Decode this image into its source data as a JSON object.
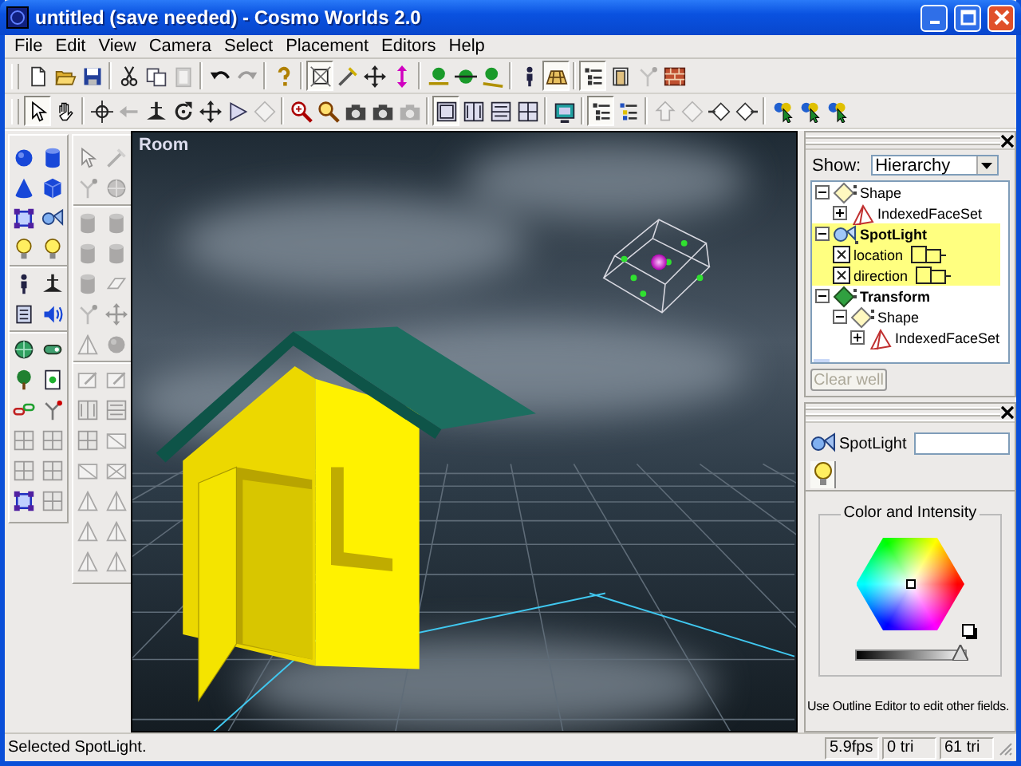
{
  "window": {
    "title": "untitled (save needed) - Cosmo Worlds 2.0"
  },
  "menu": [
    "File",
    "Edit",
    "View",
    "Camera",
    "Select",
    "Placement",
    "Editors",
    "Help"
  ],
  "toolbars": [
    {
      "groups": [
        [
          {
            "kind": "page",
            "pressed": false,
            "disabled": false
          },
          {
            "kind": "folder",
            "pressed": false,
            "disabled": false
          },
          {
            "kind": "floppy",
            "pressed": false,
            "disabled": false
          }
        ],
        [
          {
            "kind": "scissors",
            "pressed": false,
            "disabled": false
          },
          {
            "kind": "copy",
            "pressed": false,
            "disabled": false
          },
          {
            "kind": "clipboard",
            "pressed": false,
            "disabled": true
          }
        ],
        [
          {
            "kind": "undo",
            "pressed": false,
            "disabled": false
          },
          {
            "kind": "redo",
            "pressed": false,
            "disabled": true
          }
        ],
        [
          {
            "kind": "help",
            "pressed": false,
            "disabled": false
          }
        ],
        [
          {
            "kind": "frame",
            "pressed": true,
            "disabled": false
          },
          {
            "kind": "wand",
            "pressed": false,
            "disabled": false
          },
          {
            "kind": "move",
            "pressed": false,
            "disabled": false
          },
          {
            "kind": "lift",
            "pressed": false,
            "disabled": false
          }
        ],
        [
          {
            "kind": "drop",
            "pressed": false,
            "disabled": false
          },
          {
            "kind": "disc",
            "pressed": false,
            "disabled": false
          },
          {
            "kind": "slope",
            "pressed": false,
            "disabled": false
          }
        ],
        [
          {
            "kind": "figure",
            "pressed": false,
            "disabled": false
          },
          {
            "kind": "grid",
            "pressed": true,
            "disabled": false
          }
        ],
        [
          {
            "kind": "list",
            "pressed": true,
            "disabled": false
          },
          {
            "kind": "door",
            "pressed": false,
            "disabled": false
          },
          {
            "kind": "fork",
            "pressed": false,
            "disabled": true
          },
          {
            "kind": "brick",
            "pressed": false,
            "disabled": false
          }
        ]
      ]
    },
    {
      "groups": [
        [
          {
            "kind": "pointer",
            "pressed": true,
            "disabled": false
          },
          {
            "kind": "hand",
            "pressed": false,
            "disabled": false
          }
        ],
        [
          {
            "kind": "target",
            "pressed": false,
            "disabled": false
          },
          {
            "kind": "left",
            "pressed": false,
            "disabled": true
          },
          {
            "kind": "pin",
            "pressed": false,
            "disabled": false
          },
          {
            "kind": "rotate",
            "pressed": false,
            "disabled": false
          },
          {
            "kind": "move",
            "pressed": false,
            "disabled": false
          },
          {
            "kind": "play",
            "pressed": false,
            "disabled": false
          },
          {
            "kind": "diamond",
            "pressed": false,
            "disabled": true
          }
        ],
        [
          {
            "kind": "zoomin",
            "pressed": false,
            "disabled": false
          },
          {
            "kind": "zoom",
            "pressed": false,
            "disabled": false
          },
          {
            "kind": "camera",
            "pressed": false,
            "disabled": false
          },
          {
            "kind": "camera",
            "pressed": false,
            "disabled": false
          },
          {
            "kind": "camera",
            "pressed": false,
            "disabled": true
          }
        ],
        [
          {
            "kind": "view1",
            "pressed": true,
            "disabled": false
          },
          {
            "kind": "view2",
            "pressed": false,
            "disabled": false
          },
          {
            "kind": "view3",
            "pressed": false,
            "disabled": false
          },
          {
            "kind": "view4",
            "pressed": false,
            "disabled": false
          }
        ],
        [
          {
            "kind": "monitor",
            "pressed": false,
            "disabled": false
          }
        ],
        [
          {
            "kind": "list",
            "pressed": true,
            "disabled": false
          },
          {
            "kind": "list2",
            "pressed": false,
            "disabled": false
          }
        ],
        [
          {
            "kind": "up",
            "pressed": false,
            "disabled": true
          },
          {
            "kind": "diamond",
            "pressed": false,
            "disabled": true
          },
          {
            "kind": "ldiamond",
            "pressed": false,
            "disabled": false
          },
          {
            "kind": "rdiamond",
            "pressed": false,
            "disabled": false
          }
        ],
        [
          {
            "kind": "cursors",
            "pressed": false,
            "disabled": false
          },
          {
            "kind": "cursors",
            "pressed": false,
            "disabled": false
          },
          {
            "kind": "cursors",
            "pressed": false,
            "disabled": false
          }
        ]
      ]
    }
  ],
  "palette": {
    "columns": [
      {
        "groups": [
          [
            {
              "kind": "sphere",
              "disabled": false
            },
            {
              "kind": "cylinder",
              "disabled": false
            },
            {
              "kind": "cone",
              "disabled": false
            },
            {
              "kind": "cube",
              "disabled": false
            },
            {
              "kind": "square",
              "disabled": false
            },
            {
              "kind": "spot",
              "disabled": false
            },
            {
              "kind": "bulb",
              "disabled": false
            },
            {
              "kind": "bulb",
              "disabled": false
            }
          ],
          [
            {
              "kind": "figure",
              "disabled": false
            },
            {
              "kind": "pin",
              "disabled": false
            },
            {
              "kind": "script",
              "disabled": false
            },
            {
              "kind": "speaker",
              "disabled": false
            }
          ],
          [
            {
              "kind": "globe",
              "disabled": false
            },
            {
              "kind": "capsule",
              "disabled": false
            },
            {
              "kind": "tree",
              "disabled": false
            },
            {
              "kind": "sheet",
              "disabled": false
            },
            {
              "kind": "chain",
              "disabled": false
            },
            {
              "kind": "fork",
              "disabled": false
            },
            {
              "kind": "view4",
              "disabled": true
            },
            {
              "kind": "view4",
              "disabled": true
            },
            {
              "kind": "view4",
              "disabled": true
            },
            {
              "kind": "view4",
              "disabled": true
            },
            {
              "kind": "square",
              "disabled": false
            },
            {
              "kind": "view4",
              "disabled": true
            }
          ]
        ]
      },
      {
        "groups": [
          [
            {
              "kind": "pointer",
              "disabled": true
            },
            {
              "kind": "wand",
              "disabled": true
            },
            {
              "kind": "fork",
              "disabled": true
            },
            {
              "kind": "globe",
              "disabled": true
            }
          ],
          [
            {
              "kind": "cylinder",
              "disabled": true
            },
            {
              "kind": "cylinder",
              "disabled": true
            },
            {
              "kind": "cylinder",
              "disabled": true
            },
            {
              "kind": "cylinder",
              "disabled": true
            },
            {
              "kind": "cylinder",
              "disabled": true
            },
            {
              "kind": "plane",
              "disabled": true
            },
            {
              "kind": "fork",
              "disabled": true
            },
            {
              "kind": "move",
              "disabled": true
            },
            {
              "kind": "triangle",
              "disabled": true
            },
            {
              "kind": "sphere",
              "disabled": true
            }
          ],
          [
            {
              "kind": "edit",
              "disabled": true
            },
            {
              "kind": "edit",
              "disabled": true
            },
            {
              "kind": "view2",
              "disabled": true
            },
            {
              "kind": "view3",
              "disabled": true
            },
            {
              "kind": "view4",
              "disabled": true
            },
            {
              "kind": "slash",
              "disabled": true
            },
            {
              "kind": "slash",
              "disabled": true
            },
            {
              "kind": "xbox",
              "disabled": true
            },
            {
              "kind": "triangle",
              "disabled": true
            },
            {
              "kind": "triangle",
              "disabled": true
            },
            {
              "kind": "triangle",
              "disabled": true
            },
            {
              "kind": "triangle",
              "disabled": true
            },
            {
              "kind": "triangle",
              "disabled": true
            },
            {
              "kind": "triangle",
              "disabled": true
            }
          ]
        ]
      }
    ]
  },
  "viewport": {
    "label": "Room"
  },
  "outline": {
    "show_label": "Show:",
    "show_value": "Hierarchy",
    "tree": [
      {
        "label": "Shape",
        "kind": "shape",
        "expanded": true,
        "selected": false,
        "children": [
          {
            "label": "IndexedFaceSet",
            "kind": "faceset",
            "expanded": false,
            "selected": false
          }
        ]
      },
      {
        "label": "SpotLight",
        "kind": "light",
        "expanded": true,
        "selected": true,
        "children": [
          {
            "label": "location",
            "kind": "field",
            "selected": true
          },
          {
            "label": "direction",
            "kind": "field",
            "selected": true
          }
        ]
      },
      {
        "label": "Transform",
        "kind": "transform",
        "expanded": true,
        "selected": false,
        "children": [
          {
            "label": "Shape",
            "kind": "shape",
            "expanded": true,
            "selected": false,
            "children": [
              {
                "label": "IndexedFaceSet",
                "kind": "faceset",
                "expanded": false,
                "selected": false
              }
            ]
          }
        ]
      }
    ],
    "clear_button": {
      "label": "Clear well",
      "disabled": true
    }
  },
  "properties": {
    "node_label": "SpotLight",
    "tabs": [
      {
        "kind": "bulb",
        "selected": true
      }
    ],
    "group_title": "Color and Intensity",
    "intensity": {
      "level": 0.96
    },
    "hint": "Use Outline Editor to edit other fields."
  },
  "status_bar": {
    "message": "Selected SpotLight.",
    "fps": "5.9fps",
    "counts": [
      "0 tri",
      "61 tri"
    ]
  }
}
